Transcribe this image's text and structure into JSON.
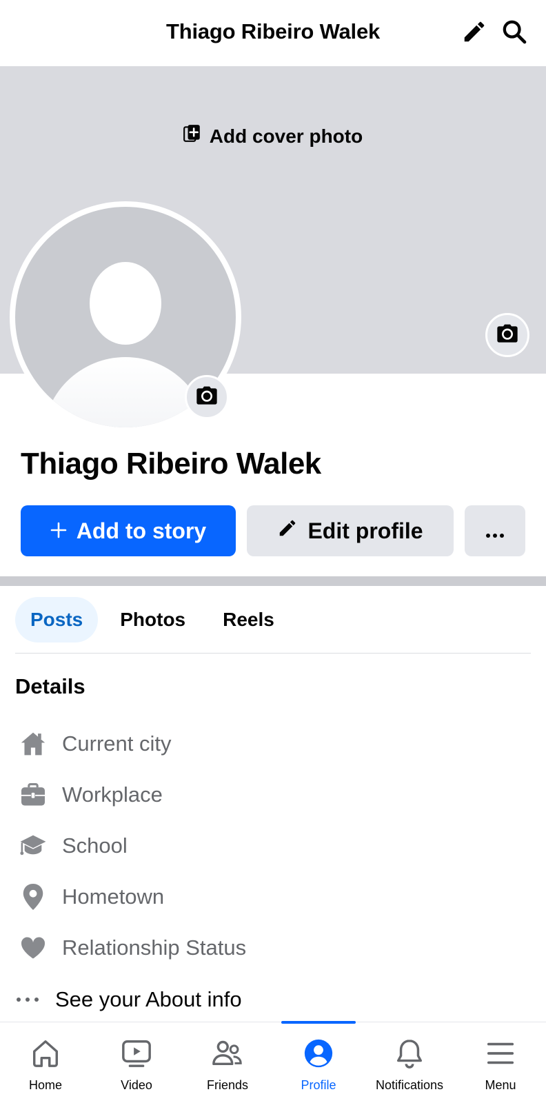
{
  "header": {
    "title": "Thiago Ribeiro Walek",
    "icons": [
      "pencil-icon",
      "search-icon"
    ]
  },
  "cover": {
    "add_cover_label": "Add cover photo",
    "color": "#d9dadf"
  },
  "profile": {
    "name": "Thiago Ribeiro Walek"
  },
  "actions": {
    "add_story_label": "Add to story",
    "edit_profile_label": "Edit profile",
    "more_label": "•••",
    "accent_color": "#0866ff"
  },
  "tabs": [
    {
      "label": "Posts",
      "active": true
    },
    {
      "label": "Photos",
      "active": false
    },
    {
      "label": "Reels",
      "active": false
    }
  ],
  "details": {
    "title": "Details",
    "items": [
      {
        "label": "Current city",
        "icon": "home-icon"
      },
      {
        "label": "Workplace",
        "icon": "briefcase-icon"
      },
      {
        "label": "School",
        "icon": "graduation-cap-icon"
      },
      {
        "label": "Hometown",
        "icon": "location-pin-icon"
      },
      {
        "label": "Relationship Status",
        "icon": "heart-icon"
      }
    ],
    "about_label": "See your About info"
  },
  "bottom_nav": [
    {
      "label": "Home",
      "icon": "home-icon",
      "active": false
    },
    {
      "label": "Video",
      "icon": "video-icon",
      "active": false
    },
    {
      "label": "Friends",
      "icon": "friends-icon",
      "active": false
    },
    {
      "label": "Profile",
      "icon": "profile-icon",
      "active": true
    },
    {
      "label": "Notifications",
      "icon": "bell-icon",
      "active": false
    },
    {
      "label": "Menu",
      "icon": "menu-icon",
      "active": false
    }
  ]
}
